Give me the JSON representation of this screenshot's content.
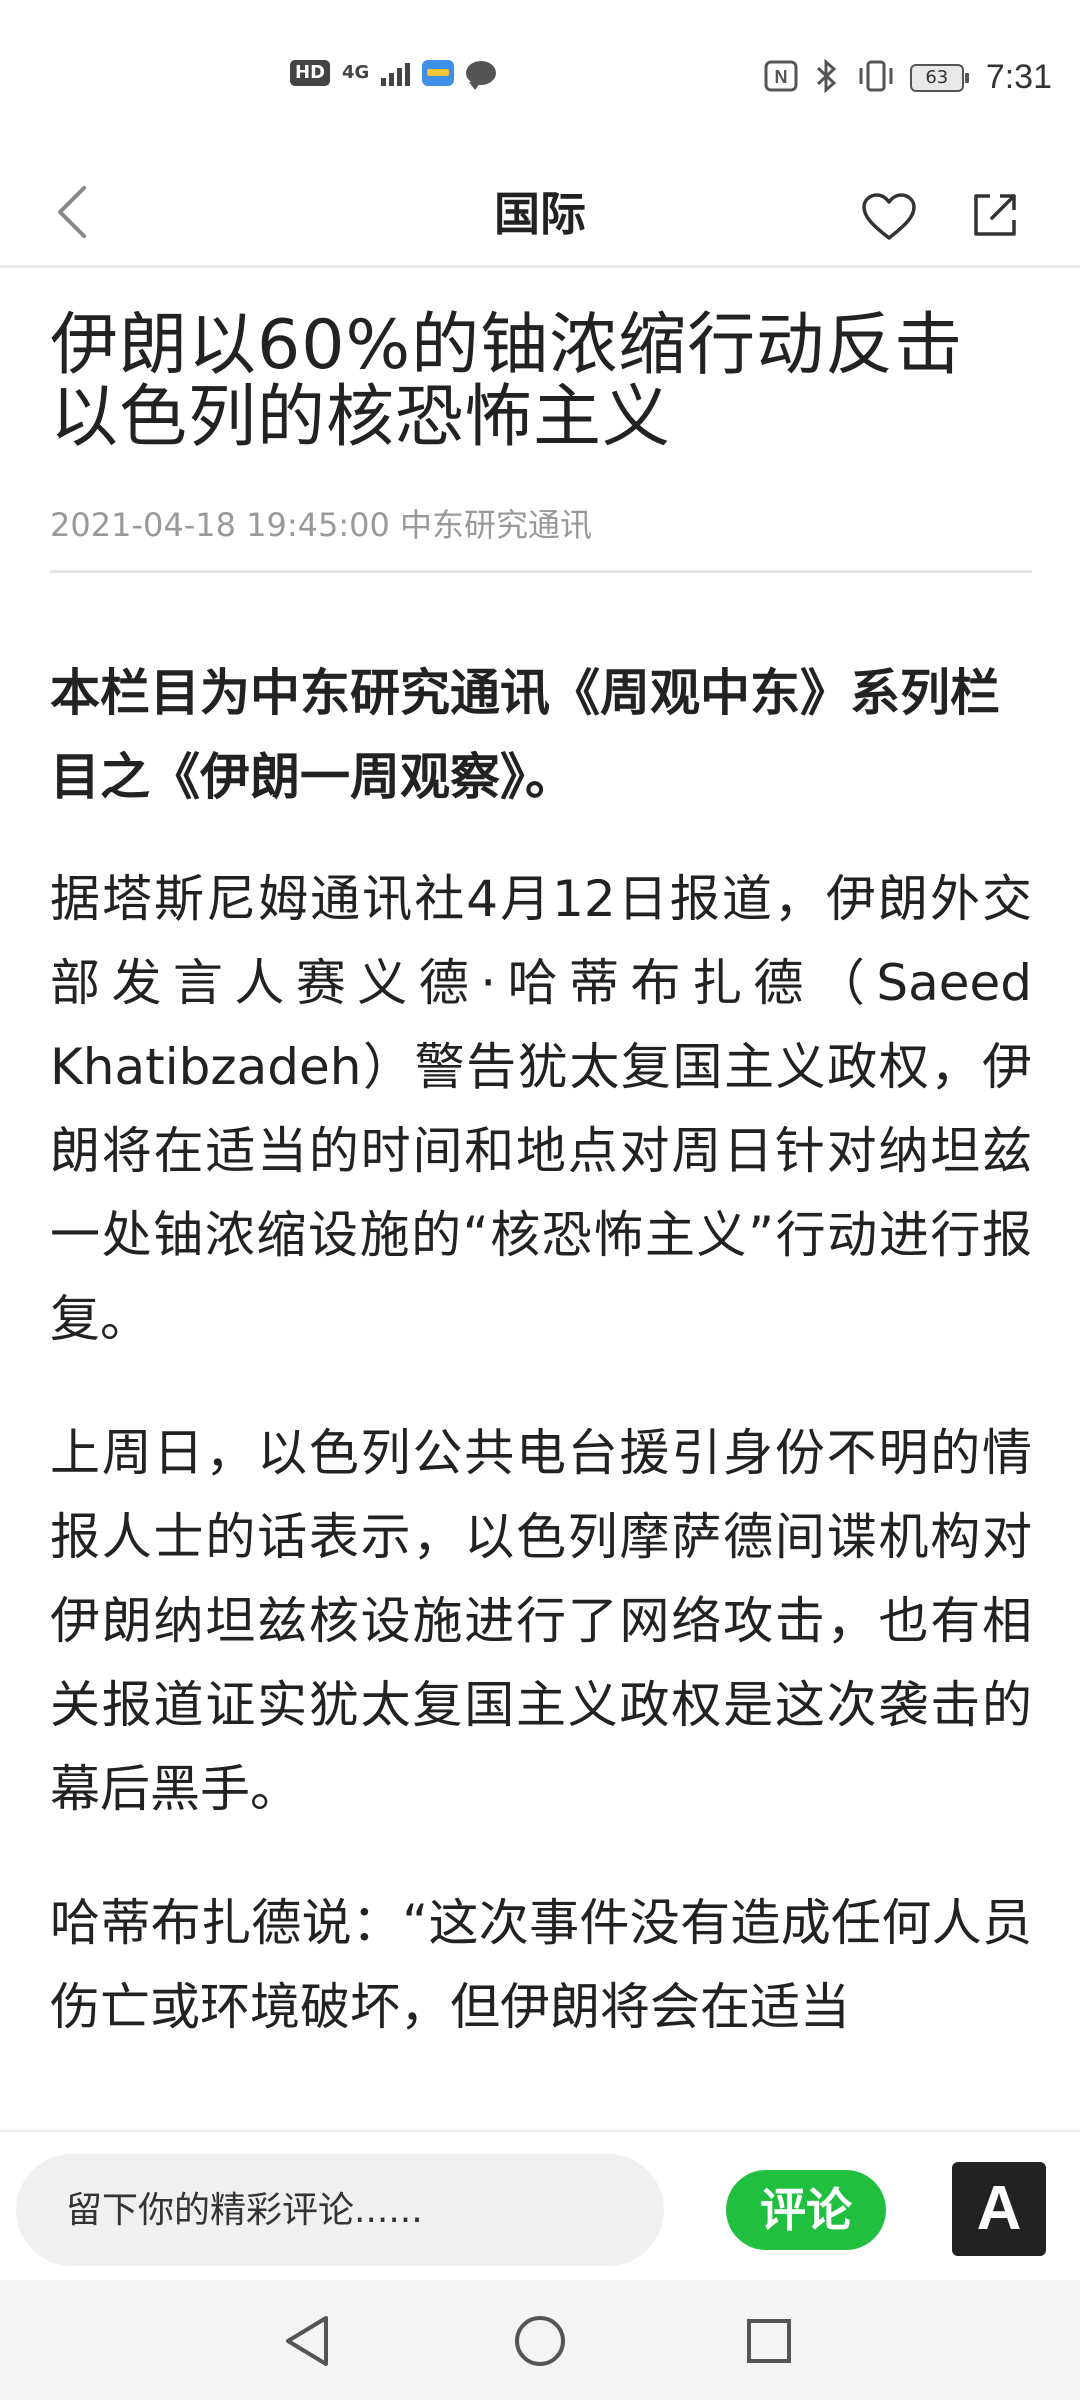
{
  "status_bar": {
    "network_badge": "HD",
    "network_type": "4G",
    "battery": "63",
    "time": "7:31",
    "icons": [
      "hd-icon",
      "signal-icon",
      "wallet-app-icon",
      "chat-icon",
      "nfc-icon",
      "bluetooth-icon",
      "vibrate-icon",
      "battery-icon"
    ]
  },
  "header": {
    "title": "国际",
    "back_icon": "chevron-left-icon",
    "favorite_icon": "heart-icon",
    "share_icon": "share-icon"
  },
  "article": {
    "title": "伊朗以60%的铀浓缩行动反击以色列的核恐怖主义",
    "date": "2021-04-18 19:45:00",
    "source": "中东研究通讯",
    "intro": "本栏目为中东研究通讯《周观中东》系列栏目之《伊朗一周观察》。",
    "paragraphs": [
      "据塔斯尼姆通讯社4月12日报道，伊朗外交部发言人赛义德·哈蒂布扎德（Saeed Khatibzadeh）警告犹太复国主义政权，伊朗将在适当的时间和地点对周日针对纳坦兹一处铀浓缩设施的“核恐怖主义”行动进行报复。",
      "上周日，以色列公共电台援引身份不明的情报人士的话表示，以色列摩萨德间谍机构对伊朗纳坦兹核设施进行了网络攻击，也有相关报道证实犹太复国主义政权是这次袭击的幕后黑手。",
      "哈蒂布扎德说：“这次事件没有造成任何人员伤亡或环境破坏，但伊朗将会在适当"
    ]
  },
  "comment_bar": {
    "placeholder": "留下你的精彩评论......",
    "comment_label": "评论",
    "font_label": "A"
  },
  "nav_bar": {
    "icons": [
      "back-triangle-icon",
      "home-circle-icon",
      "recents-square-icon"
    ]
  }
}
